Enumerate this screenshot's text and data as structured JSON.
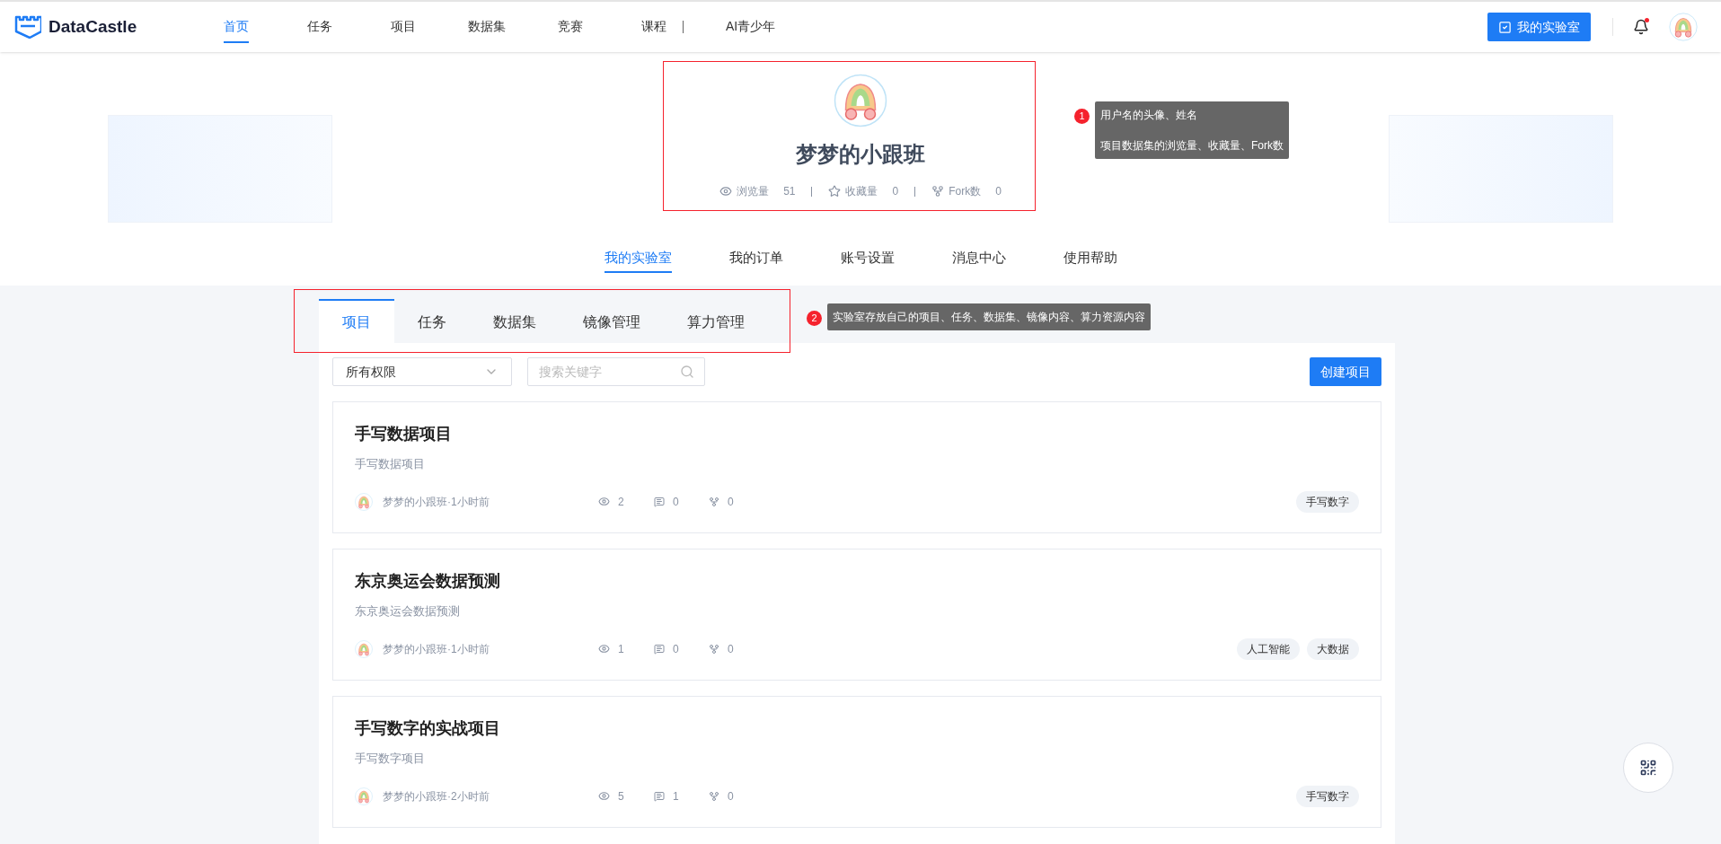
{
  "nav": {
    "logo": "DataCastle",
    "items": [
      {
        "label": "首页",
        "selected": true
      },
      {
        "label": "任务",
        "selected": false
      },
      {
        "label": "项目",
        "selected": false
      },
      {
        "label": "数据集",
        "selected": false
      },
      {
        "label": "竞赛",
        "selected": false
      },
      {
        "label": "课程",
        "selected": false
      },
      {
        "label": "AI青少年",
        "selected": false
      }
    ],
    "lab_button": "我的实验室"
  },
  "profile": {
    "name": "梦梦的小跟班",
    "stats": [
      {
        "kind": "views",
        "label": "浏览量",
        "value": "51"
      },
      {
        "kind": "favorites",
        "label": "收藏量",
        "value": "0"
      },
      {
        "kind": "forks",
        "label": "Fork数",
        "value": "0"
      }
    ]
  },
  "annotations": [
    {
      "number": "1",
      "lines": [
        "用户名的头像、姓名",
        "项目数据集的浏览量、收藏量、Fork数"
      ]
    },
    {
      "number": "2",
      "lines": [
        "实验室存放自己的项目、任务、数据集、镜像内容、算力资源内容"
      ]
    }
  ],
  "profile_tabs": [
    {
      "label": "我的实验室",
      "selected": true
    },
    {
      "label": "我的订单",
      "selected": false
    },
    {
      "label": "账号设置",
      "selected": false
    },
    {
      "label": "消息中心",
      "selected": false
    },
    {
      "label": "使用帮助",
      "selected": false
    }
  ],
  "lab_tabs": [
    {
      "label": "项目",
      "selected": true
    },
    {
      "label": "任务",
      "selected": false
    },
    {
      "label": "数据集",
      "selected": false
    },
    {
      "label": "镜像管理",
      "selected": false
    },
    {
      "label": "算力管理",
      "selected": false
    }
  ],
  "filter": {
    "permission": "所有权限",
    "search_placeholder": "搜索关键字",
    "create_button": "创建项目"
  },
  "projects": [
    {
      "title": "手写数据项目",
      "description": "手写数据项目",
      "author_time": "梦梦的小跟班·1小时前",
      "views": "2",
      "comments": "0",
      "forks": "0",
      "tags": [
        "手写数字"
      ]
    },
    {
      "title": "东京奥运会数据预测",
      "description": "东京奥运会数据预测",
      "author_time": "梦梦的小跟班·1小时前",
      "views": "1",
      "comments": "0",
      "forks": "0",
      "tags": [
        "人工智能",
        "大数据"
      ]
    },
    {
      "title": "手写数字的实战项目",
      "description": "手写数字项目",
      "author_time": "梦梦的小跟班·2小时前",
      "views": "5",
      "comments": "1",
      "forks": "0",
      "tags": [
        "手写数字"
      ]
    }
  ]
}
